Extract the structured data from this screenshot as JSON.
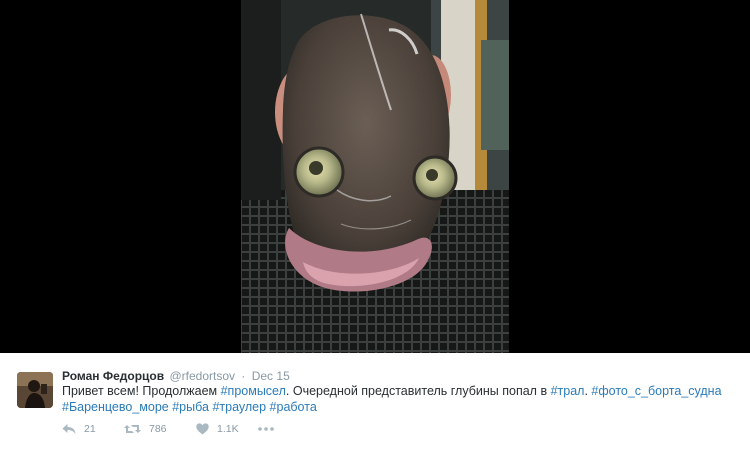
{
  "media": {
    "alt_icon": "fish-photo"
  },
  "tweet": {
    "fullname": "Роман Федорцов",
    "username": "@rfedortsov",
    "separator": "·",
    "time": "Dec 15",
    "text_lead": "Привет всем! Продолжаем ",
    "hashtag_1": "#промысел",
    "text_mid": ". Очередной представитель глубины попал в ",
    "hashtag_2": "#трал",
    "text_tail": ". ",
    "hashtag_3": "#фото_с_борта_судна",
    "hashtag_4": "#Баренцево_море",
    "hashtag_5": "#рыба",
    "hashtag_6": "#траулер",
    "hashtag_7": "#работа",
    "actions": {
      "reply_count": "21",
      "retweet_count": "786",
      "like_count": "1.1K",
      "more_icon": "more-dots-icon"
    }
  },
  "colors": {
    "link": "#2b7bb9",
    "text": "#292f33",
    "muted": "#8899a6",
    "icon": "#aab8c2"
  }
}
